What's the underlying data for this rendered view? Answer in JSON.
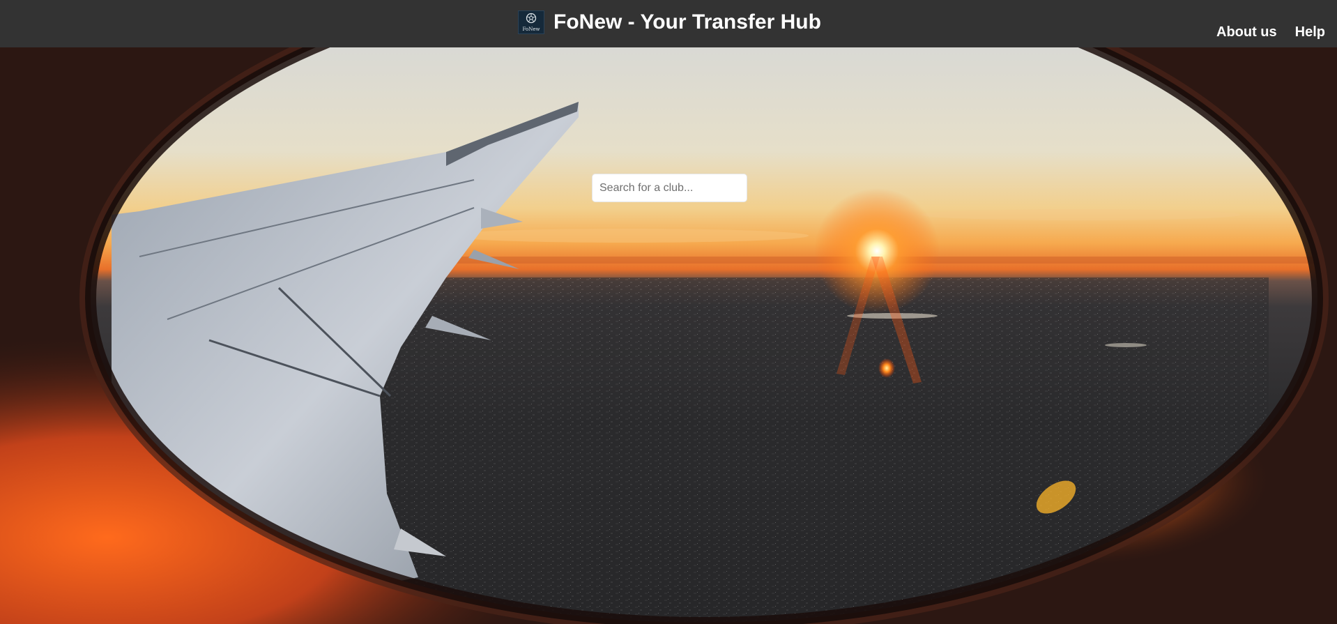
{
  "header": {
    "logo": {
      "icon": "football-icon",
      "text": "FoNew"
    },
    "title": "FoNew - Your Transfer Hub",
    "nav": [
      {
        "label": "About us"
      },
      {
        "label": "Help"
      }
    ]
  },
  "hero": {
    "background": "airplane-window-sunset-photo",
    "search": {
      "placeholder": "Search for a club...",
      "value": ""
    }
  },
  "colors": {
    "header_bg": "#333333",
    "header_text": "#ffffff",
    "sky_top": "#dcdcd6",
    "sunset_orange": "#f26c1e",
    "window_frame": "#2a1410"
  }
}
